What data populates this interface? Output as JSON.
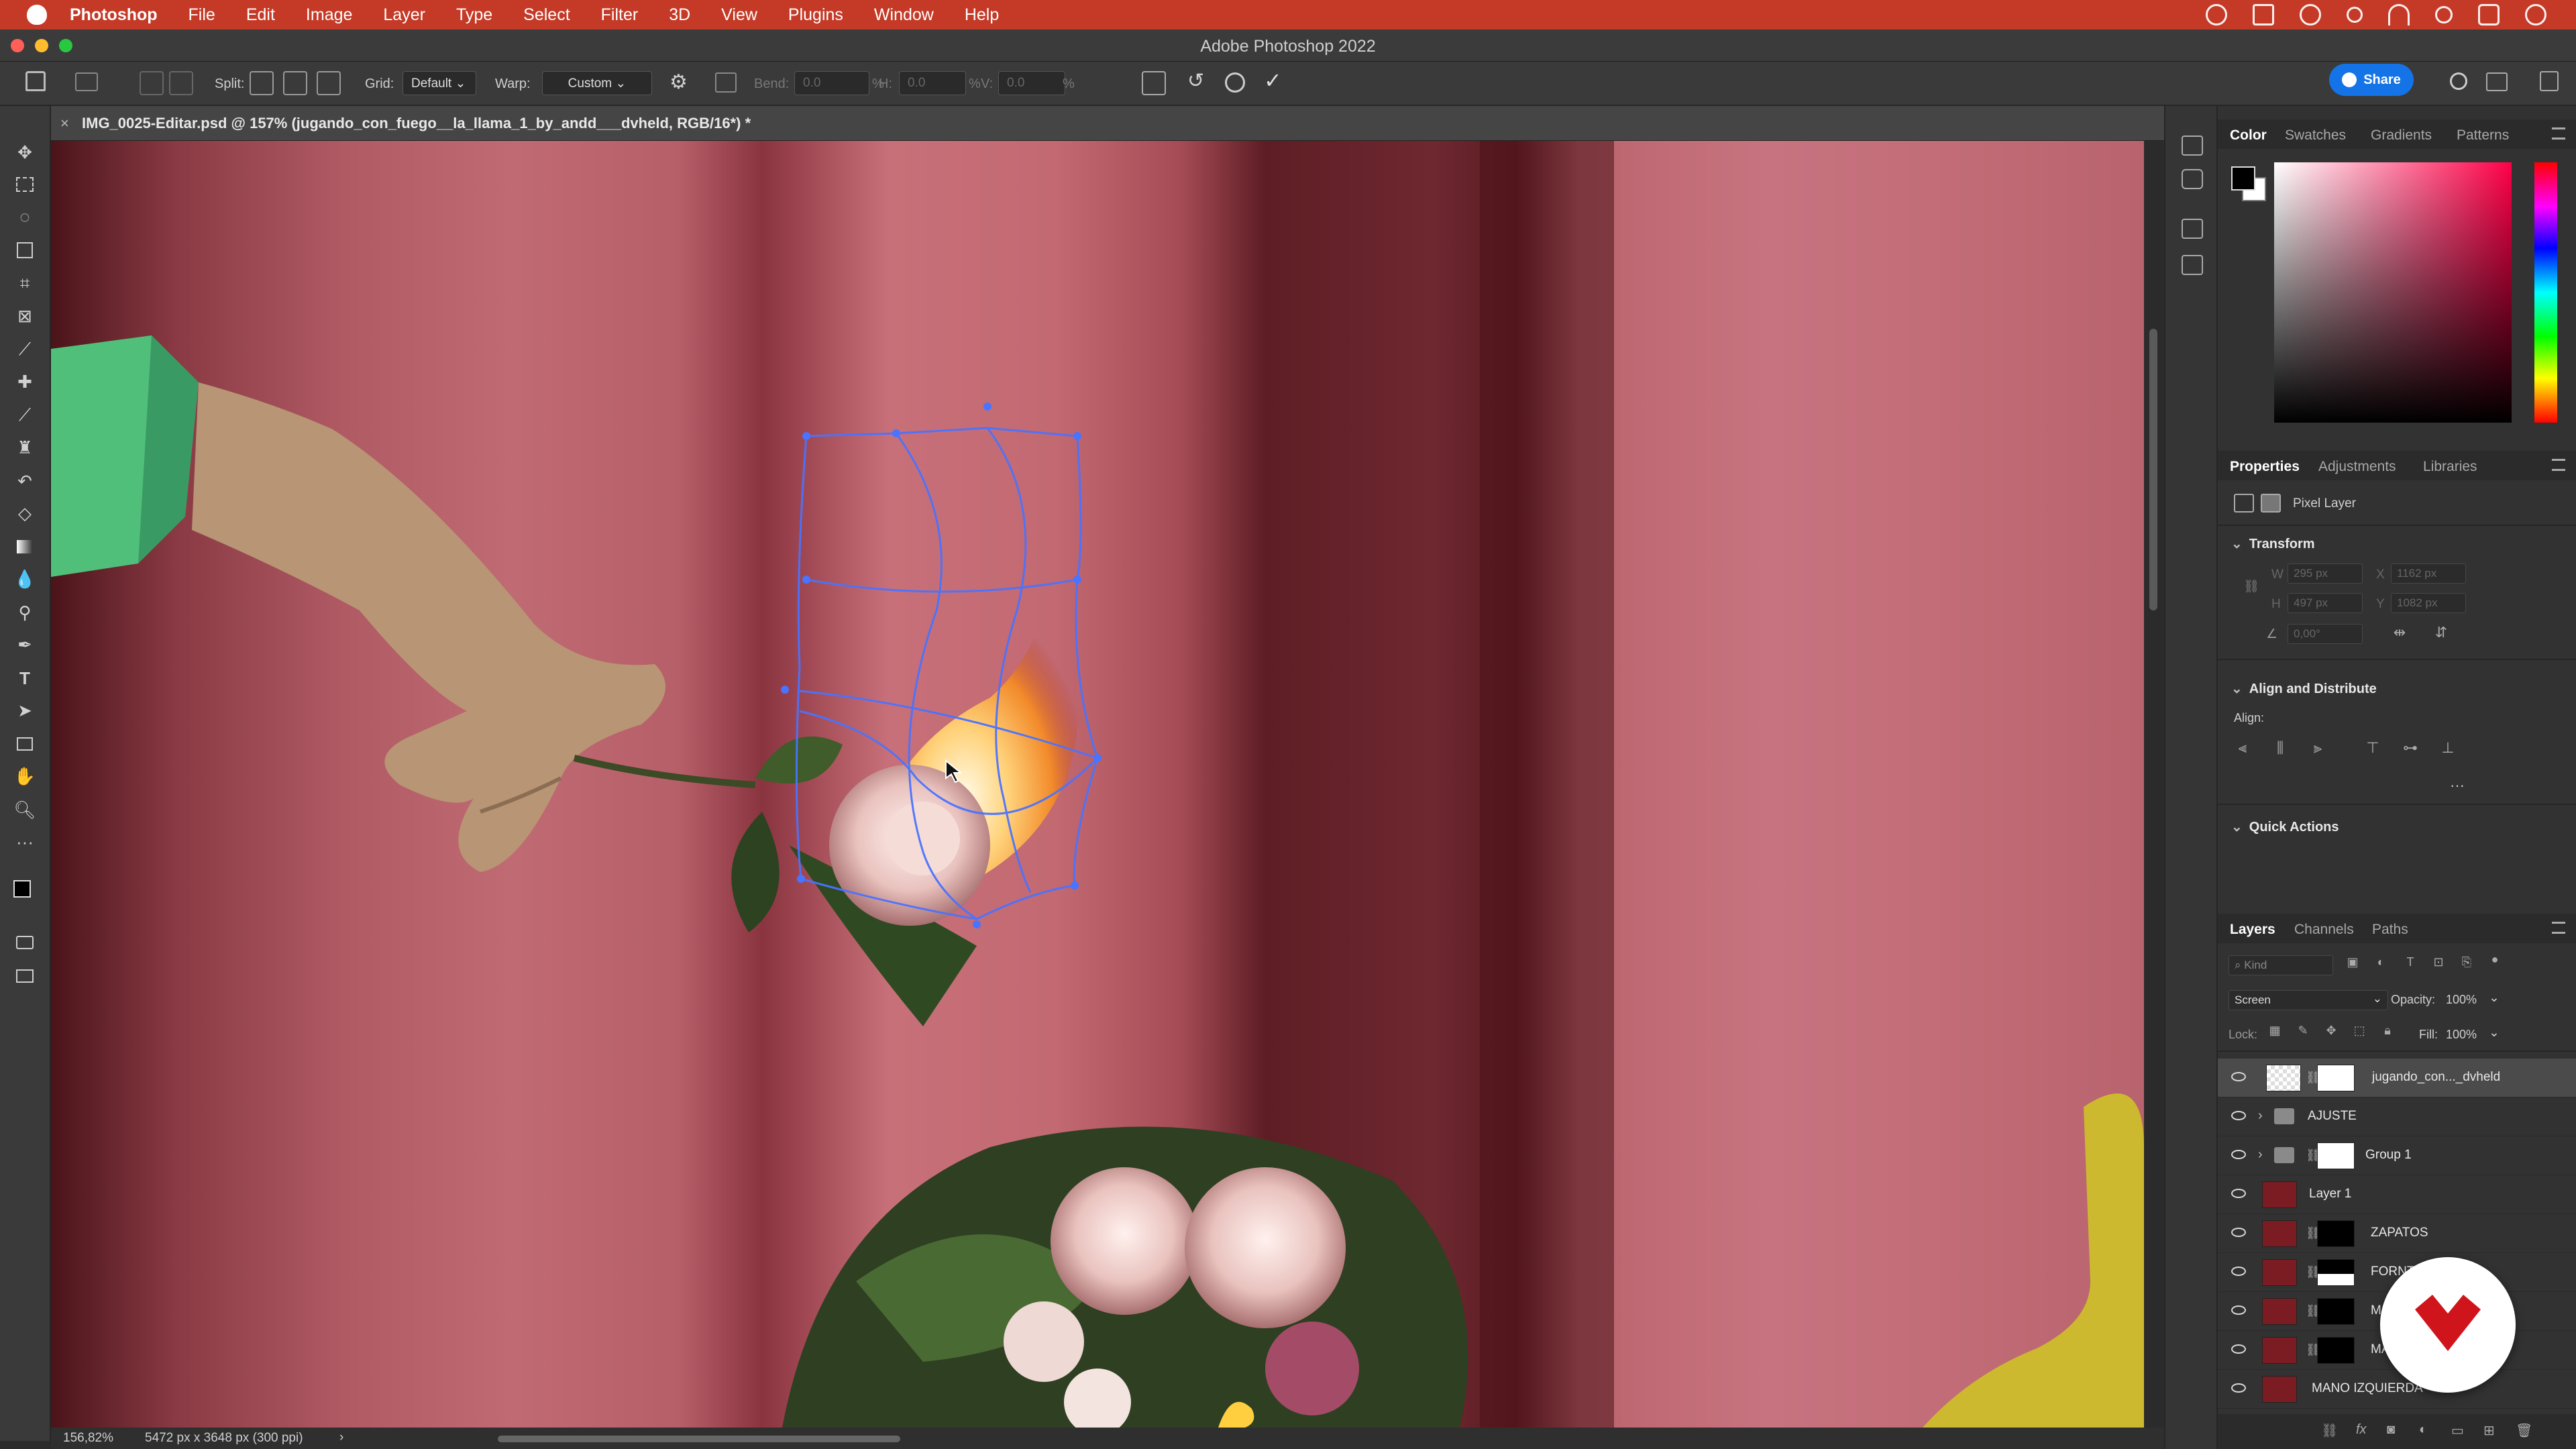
{
  "menubar": {
    "app": "Photoshop",
    "items": [
      "File",
      "Edit",
      "Image",
      "Layer",
      "Type",
      "Select",
      "Filter",
      "3D",
      "View",
      "Plugins",
      "Window",
      "Help"
    ]
  },
  "window": {
    "title": "Adobe Photoshop 2022"
  },
  "options_bar": {
    "split_label": "Split:",
    "grid_label": "Grid:",
    "grid_value": "Default",
    "warp_label": "Warp:",
    "warp_value": "Custom",
    "bend_label": "Bend:",
    "bend_value": "0.0",
    "bend_unit": "%",
    "h_label": "H:",
    "h_value": "0.0",
    "h_unit": "%",
    "v_label": "V:",
    "v_value": "0.0",
    "v_unit": "%",
    "share_label": "Share"
  },
  "document": {
    "tab_title": "IMG_0025-Editar.psd @ 157% (jugando_con_fuego__la_llama_1_by_andd___dvheld, RGB/16*) *",
    "close_glyph": "×"
  },
  "status": {
    "zoom": "156,82%",
    "doc_size": "5472 px x 3648 px (300 ppi)",
    "arrow": "›"
  },
  "color_panel": {
    "tabs": [
      "Color",
      "Swatches",
      "Gradients",
      "Patterns"
    ],
    "active_tab": "Color",
    "foreground": "#000000",
    "background": "#ffffff",
    "hue": "#ff0048"
  },
  "properties_panel": {
    "tabs": [
      "Properties",
      "Adjustments",
      "Libraries"
    ],
    "active_tab": "Properties",
    "layer_kind": "Pixel Layer",
    "transform_title": "Transform",
    "w_label": "W",
    "w_value": "295 px",
    "x_label": "X",
    "x_value": "1162 px",
    "h_label": "H",
    "h_value": "497 px",
    "y_label": "Y",
    "y_value": "1082 px",
    "angle_value": "0,00°",
    "align_title": "Align and Distribute",
    "align_label": "Align:",
    "more_glyph": "···",
    "quick_actions_title": "Quick Actions"
  },
  "layers_panel": {
    "tabs": [
      "Layers",
      "Channels",
      "Paths"
    ],
    "active_tab": "Layers",
    "kind_placeholder": "Kind",
    "blend_mode": "Screen",
    "opacity_label": "Opacity:",
    "opacity_value": "100%",
    "lock_label": "Lock:",
    "fill_label": "Fill:",
    "fill_value": "100%",
    "layers": [
      {
        "name": "jugando_con..._dvheld",
        "selected": true
      },
      {
        "name": "AJUSTE"
      },
      {
        "name": "Group 1"
      },
      {
        "name": "Layer 1"
      },
      {
        "name": "ZAPATOS"
      },
      {
        "name": "FORNTAL"
      },
      {
        "name": "MA"
      },
      {
        "name": "MA"
      },
      {
        "name": "MANO IZQUIERDA"
      }
    ]
  },
  "brand": {
    "accent": "#1473e6",
    "menubar": "#c43a27",
    "badge": "#d0141c"
  }
}
